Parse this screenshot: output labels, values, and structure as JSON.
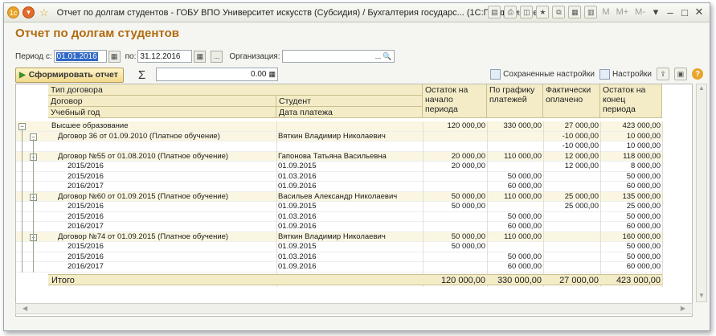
{
  "window": {
    "title": "Отчет по долгам студентов - ГОБУ ВПО Университет искусств (Субсидия) / Бухгалтерия государс... (1С:Предприятие)",
    "tool_labels": [
      "M",
      "M+",
      "M-"
    ]
  },
  "report": {
    "title": "Отчет по долгам студентов",
    "period_label": "Период с:",
    "date_from": "01.01.2016",
    "to_label": "по:",
    "date_to": "31.12.2016",
    "dots": "...",
    "org_label": "Организация:",
    "org_value": "",
    "run_button": "Сформировать отчет",
    "sigma": "Σ",
    "sum_value": "0.00",
    "saved_settings": "Сохраненные настройки",
    "settings": "Настройки"
  },
  "columns": {
    "group1": "Тип договора",
    "group2": "Договор",
    "group3": "Учебный год",
    "student": "Студент",
    "pay_date": "Дата платежа",
    "col_start": "Остаток на начало периода",
    "col_sched": "По графику платежей",
    "col_paid": "Фактически оплачено",
    "col_end": "Остаток на конец периода"
  },
  "rows": [
    {
      "name": "Высшее образование",
      "student": "",
      "start": "120 000,00",
      "sched": "330 000,00",
      "paid": "27 000,00",
      "end": "423 000,00",
      "level": 0
    },
    {
      "name": "Договор 36 от 01.09.2010 (Платное обучение)",
      "student": "Вяткин Владимир Николаевич",
      "start": "",
      "sched": "",
      "paid": "-10 000,00",
      "end": "10 000,00",
      "level": 1
    },
    {
      "name": "",
      "student": "",
      "start": "",
      "sched": "",
      "paid": "-10 000,00",
      "end": "10 000,00",
      "level": 2
    },
    {
      "name": "Договор №55 от 01.08.2010 (Платное обучение)",
      "student": "Гапонова Татьяна Васильевна",
      "start": "20 000,00",
      "sched": "110 000,00",
      "paid": "12 000,00",
      "end": "118 000,00",
      "level": 1
    },
    {
      "name": "2015/2016",
      "student": "01.09.2015",
      "start": "20 000,00",
      "sched": "",
      "paid": "12 000,00",
      "end": "8 000,00",
      "level": 2
    },
    {
      "name": "2015/2016",
      "student": "01.03.2016",
      "start": "",
      "sched": "50 000,00",
      "paid": "",
      "end": "50 000,00",
      "level": 2
    },
    {
      "name": "2016/2017",
      "student": "01.09.2016",
      "start": "",
      "sched": "60 000,00",
      "paid": "",
      "end": "60 000,00",
      "level": 2
    },
    {
      "name": "Договор №60 от 01.09.2015 (Платное обучение)",
      "student": "Васильев Александр Николаевич",
      "start": "50 000,00",
      "sched": "110 000,00",
      "paid": "25 000,00",
      "end": "135 000,00",
      "level": 1
    },
    {
      "name": "2015/2016",
      "student": "01.09.2015",
      "start": "50 000,00",
      "sched": "",
      "paid": "25 000,00",
      "end": "25 000,00",
      "level": 2
    },
    {
      "name": "2015/2016",
      "student": "01.03.2016",
      "start": "",
      "sched": "50 000,00",
      "paid": "",
      "end": "50 000,00",
      "level": 2
    },
    {
      "name": "2016/2017",
      "student": "01.09.2016",
      "start": "",
      "sched": "60 000,00",
      "paid": "",
      "end": "60 000,00",
      "level": 2
    },
    {
      "name": "Договор №74 от 01.09.2015 (Платное обучение)",
      "student": "Вяткин Владимир Николаевич",
      "start": "50 000,00",
      "sched": "110 000,00",
      "paid": "",
      "end": "160 000,00",
      "level": 1
    },
    {
      "name": "2015/2016",
      "student": "01.09.2015",
      "start": "50 000,00",
      "sched": "",
      "paid": "",
      "end": "50 000,00",
      "level": 2
    },
    {
      "name": "2015/2016",
      "student": "01.03.2016",
      "start": "",
      "sched": "50 000,00",
      "paid": "",
      "end": "50 000,00",
      "level": 2
    },
    {
      "name": "2016/2017",
      "student": "01.09.2016",
      "start": "",
      "sched": "60 000,00",
      "paid": "",
      "end": "60 000,00",
      "level": 2
    }
  ],
  "total": {
    "label": "Итого",
    "start": "120 000,00",
    "sched": "330 000,00",
    "paid": "27 000,00",
    "end": "423 000,00"
  },
  "colors": {
    "title": "#b26a10",
    "header_bg": "#f3ecc7",
    "selection": "#3168c5"
  }
}
